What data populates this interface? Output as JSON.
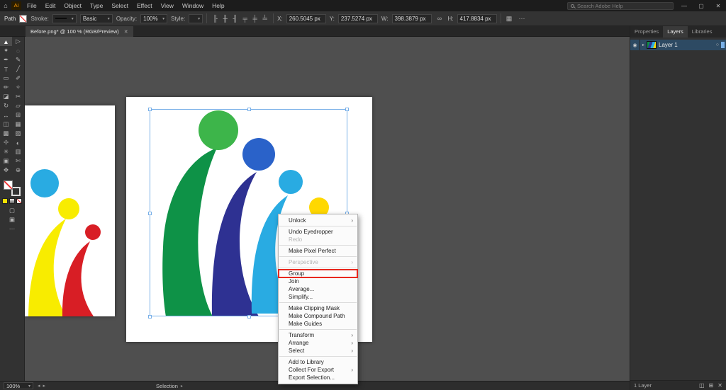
{
  "colors": {
    "canvas_bg": "#4f4f4f",
    "selection": "#79b0e8",
    "annotation_red": "#e8281e"
  },
  "icons": {
    "home": "⌂",
    "logo": "Ai",
    "minimize": "—",
    "maximize": "▢",
    "close": "✕",
    "dropdown": "▾",
    "submenu": "›",
    "eye": "◉",
    "target": "○",
    "chevron": "▸",
    "overflow": "⋯",
    "link": "∞",
    "mask": "◫",
    "new_layer": "⊞",
    "trash": "✕"
  },
  "menu_bar": {
    "menus": [
      "File",
      "Edit",
      "Object",
      "Type",
      "Select",
      "Effect",
      "View",
      "Window",
      "Help"
    ]
  },
  "search": {
    "placeholder": "Search Adobe Help"
  },
  "control_bar": {
    "object_label": "Path",
    "stroke_label": "Stroke:",
    "brush_value": "Basic",
    "opacity_label": "Opacity:",
    "opacity_value": "100%",
    "style_label": "Style:",
    "align_buttons": [
      {
        "name": "horizontal-align-left",
        "glyph": "╟"
      },
      {
        "name": "horizontal-align-center",
        "glyph": "╫"
      },
      {
        "name": "horizontal-align-right",
        "glyph": "╢"
      },
      {
        "name": "vertical-align-top",
        "glyph": "╤"
      },
      {
        "name": "vertical-align-center",
        "glyph": "╪"
      },
      {
        "name": "vertical-align-bottom",
        "glyph": "╧"
      }
    ],
    "x_label": "X:",
    "x_value": "260.5045 px",
    "y_label": "Y:",
    "y_value": "237.5274 px",
    "w_label": "W:",
    "w_value": "398.3879 px",
    "h_label": "H:",
    "h_value": "417.8834 px",
    "transform_glyph": "▦"
  },
  "document_tab": {
    "title": "Before.png* @ 100 % (RGB/Preview)"
  },
  "toolbar": {
    "tools": [
      {
        "name": "selection",
        "glyph": "▲"
      },
      {
        "name": "direct-selection",
        "glyph": "▷"
      },
      {
        "name": "magic-wand",
        "glyph": "✦"
      },
      {
        "name": "lasso",
        "glyph": "◌"
      },
      {
        "name": "pen",
        "glyph": "✒"
      },
      {
        "name": "curvature",
        "glyph": "✎"
      },
      {
        "name": "type",
        "glyph": "T"
      },
      {
        "name": "line-segment",
        "glyph": "╱"
      },
      {
        "name": "rectangle",
        "glyph": "▭"
      },
      {
        "name": "paintbrush",
        "glyph": "✐"
      },
      {
        "name": "pencil",
        "glyph": "✏"
      },
      {
        "name": "shaper",
        "glyph": "✧"
      },
      {
        "name": "eraser",
        "glyph": "◪"
      },
      {
        "name": "scissors",
        "glyph": "✂"
      },
      {
        "name": "rotate",
        "glyph": "↻"
      },
      {
        "name": "scale",
        "glyph": "▱"
      },
      {
        "name": "width",
        "glyph": "↔"
      },
      {
        "name": "free-transform",
        "glyph": "⊞"
      },
      {
        "name": "shape-builder",
        "glyph": "◫"
      },
      {
        "name": "perspective-grid",
        "glyph": "▦"
      },
      {
        "name": "mesh",
        "glyph": "▩"
      },
      {
        "name": "gradient",
        "glyph": "▨"
      },
      {
        "name": "eyedropper",
        "glyph": "✢"
      },
      {
        "name": "blend",
        "glyph": "◐"
      },
      {
        "name": "symbol-sprayer",
        "glyph": "✳"
      },
      {
        "name": "column-graph",
        "glyph": "▥"
      },
      {
        "name": "artboard",
        "glyph": "▣"
      },
      {
        "name": "slice",
        "glyph": "✄"
      },
      {
        "name": "hand",
        "glyph": "✥"
      },
      {
        "name": "zoom",
        "glyph": "⊕"
      }
    ],
    "draw_mode_glyph": "▢",
    "screen_mode_glyph": "▣"
  },
  "artwork": {
    "main": {
      "head_green": "#3db54a",
      "body_green": "#0e9247",
      "head_blue": "#2a62c9",
      "body_blue": "#2e3192",
      "cyan": "#29abe2",
      "yellow": "#ffd800"
    },
    "left": {
      "cyan": "#29abe2",
      "yellow": "#f8ec00",
      "red": "#d81e25"
    }
  },
  "context_menu": {
    "items": [
      {
        "label": "Unlock",
        "submenu": true
      },
      {
        "sep": true
      },
      {
        "label": "Undo Eyedropper"
      },
      {
        "label": "Redo",
        "disabled": true
      },
      {
        "sep": true
      },
      {
        "label": "Make Pixel Perfect"
      },
      {
        "sep": true
      },
      {
        "label": "Perspective",
        "disabled": true,
        "submenu": true
      },
      {
        "sep": true
      },
      {
        "label": "Group",
        "highlighted": true
      },
      {
        "label": "Join"
      },
      {
        "label": "Average..."
      },
      {
        "label": "Simplify..."
      },
      {
        "sep": true
      },
      {
        "label": "Make Clipping Mask"
      },
      {
        "label": "Make Compound Path"
      },
      {
        "label": "Make Guides"
      },
      {
        "sep": true
      },
      {
        "label": "Transform",
        "submenu": true
      },
      {
        "label": "Arrange",
        "submenu": true
      },
      {
        "label": "Select",
        "submenu": true
      },
      {
        "sep": true
      },
      {
        "label": "Add to Library"
      },
      {
        "label": "Collect For Export",
        "submenu": true
      },
      {
        "label": "Export Selection..."
      }
    ]
  },
  "right_panel": {
    "tabs": [
      "Properties",
      "Layers",
      "Libraries"
    ],
    "active_tab": "Layers",
    "layer": {
      "name": "Layer 1"
    },
    "footer": {
      "count": "1 Layer"
    }
  },
  "status_bar": {
    "zoom": "100%",
    "status": "Selection"
  }
}
